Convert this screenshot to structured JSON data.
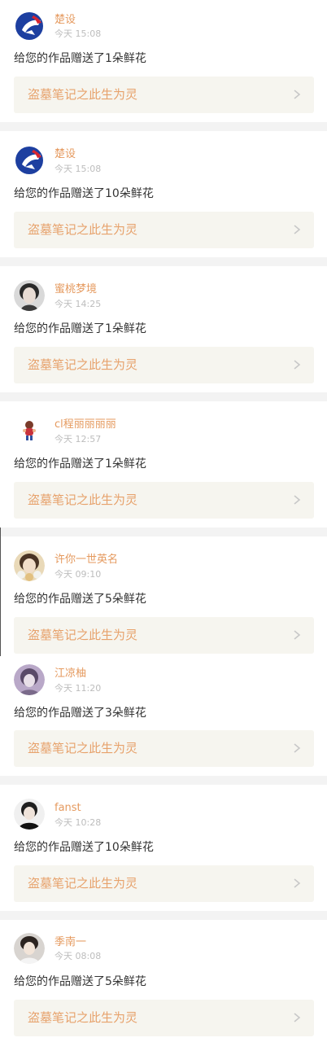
{
  "accent_color": "#e59a5f",
  "notifications": [
    {
      "username": "楚设",
      "time": "今天 15:08",
      "message": "给您的作品赠送了1朵鲜花",
      "work_title": "盗墓笔记之此生为灵",
      "avatar_icon": "blue-red-logo-avatar"
    },
    {
      "username": "楚设",
      "time": "今天 15:08",
      "message": "给您的作品赠送了10朵鲜花",
      "work_title": "盗墓笔记之此生为灵",
      "avatar_icon": "blue-red-logo-avatar"
    },
    {
      "username": "蜜桃梦境",
      "time": "今天 14:25",
      "message": "给您的作品赠送了1朵鲜花",
      "work_title": "盗墓笔记之此生为灵",
      "avatar_icon": "dark-hair-portrait-avatar"
    },
    {
      "username": "cl程丽丽丽丽",
      "time": "今天 12:57",
      "message": "给您的作品赠送了1朵鲜花",
      "work_title": "盗墓笔记之此生为灵",
      "avatar_icon": "cartoon-figure-avatar"
    },
    {
      "username": "许你一世英名",
      "time": "今天 09:10",
      "message": "给您的作品赠送了5朵鲜花",
      "work_title": "盗墓笔记之此生为灵",
      "avatar_icon": "flower-portrait-avatar"
    },
    {
      "username": "江凉柚",
      "time": "今天 11:20",
      "message": "给您的作品赠送了3朵鲜花",
      "work_title": "盗墓笔记之此生为灵",
      "avatar_icon": "purple-portrait-avatar"
    },
    {
      "username": "fanst",
      "time": "今天 10:28",
      "message": "给您的作品赠送了10朵鲜花",
      "work_title": "盗墓笔记之此生为灵",
      "avatar_icon": "dark-portrait-avatar"
    },
    {
      "username": "季南一",
      "time": "今天 08:08",
      "message": "给您的作品赠送了5朵鲜花",
      "work_title": "盗墓笔记之此生为灵",
      "avatar_icon": "boy-portrait-avatar"
    }
  ]
}
